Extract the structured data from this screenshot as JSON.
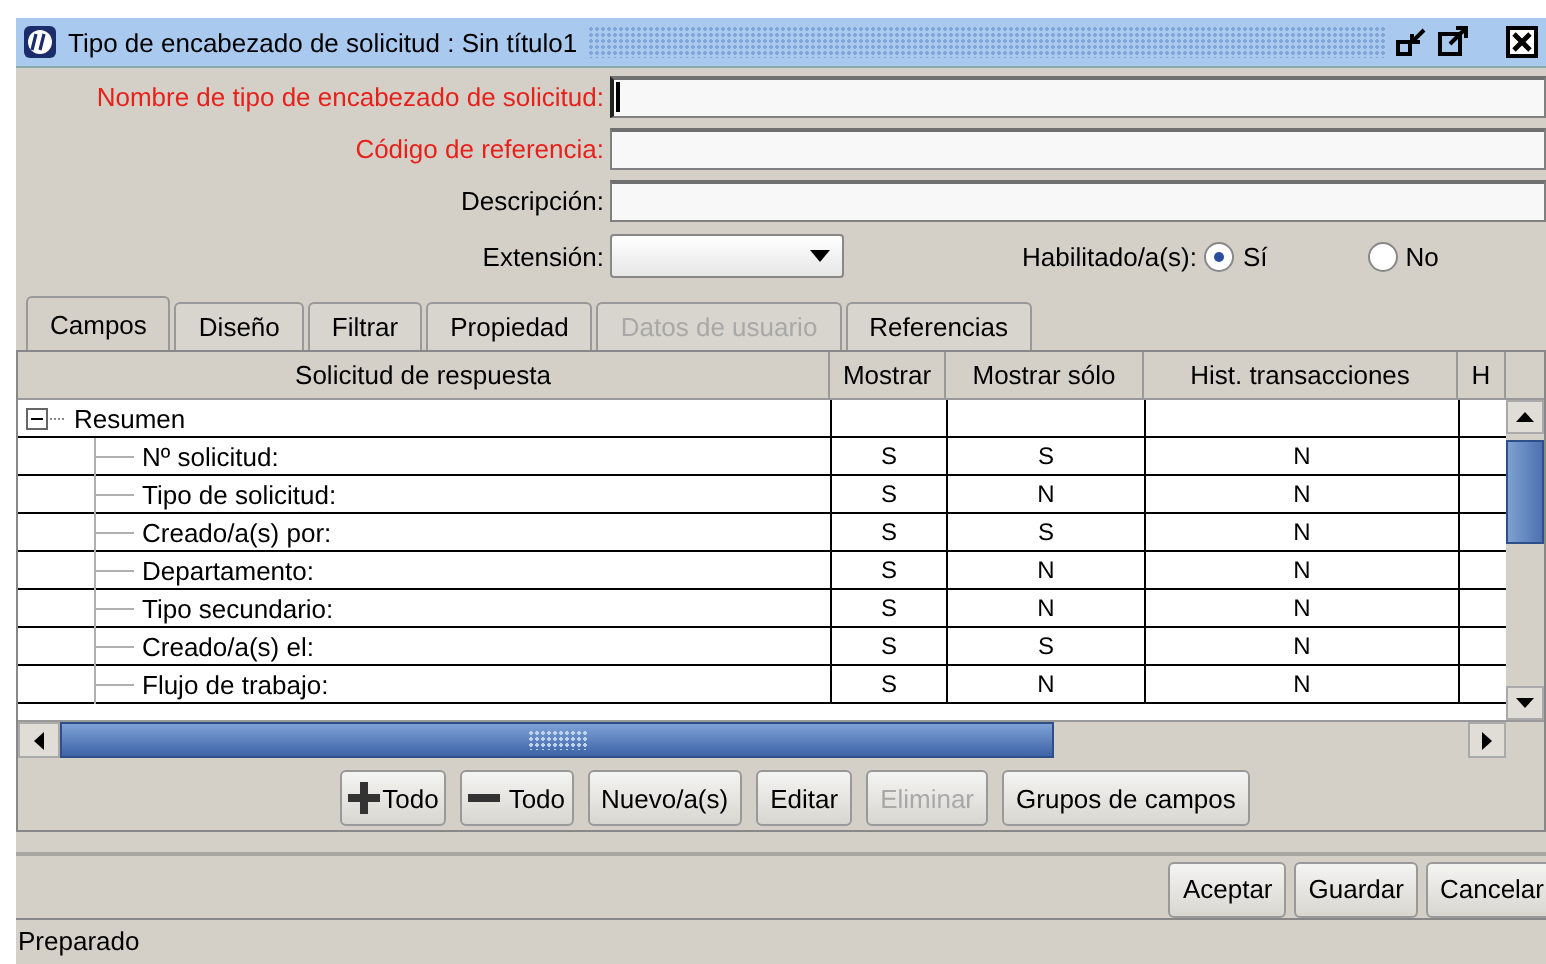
{
  "window": {
    "title": "Tipo de encabezado de solicitud : Sin título1"
  },
  "form": {
    "fields": [
      {
        "label": "Nombre de tipo de encabezado de solicitud:",
        "required": true,
        "focused": true
      },
      {
        "label": "Código de referencia:",
        "required": true,
        "focused": false
      },
      {
        "label": "Descripción:",
        "required": false,
        "focused": false
      }
    ],
    "extension_label": "Extensión:",
    "enabled_label": "Habilitado/a(s):",
    "enabled_options": [
      {
        "label": "Sí",
        "selected": true
      },
      {
        "label": "No",
        "selected": false
      }
    ]
  },
  "tabs": [
    {
      "label": "Campos",
      "selected": true,
      "disabled": false
    },
    {
      "label": "Diseño",
      "selected": false,
      "disabled": false
    },
    {
      "label": "Filtrar",
      "selected": false,
      "disabled": false
    },
    {
      "label": "Propiedad",
      "selected": false,
      "disabled": false
    },
    {
      "label": "Datos de usuario",
      "selected": false,
      "disabled": true
    },
    {
      "label": "Referencias",
      "selected": false,
      "disabled": false
    }
  ],
  "table": {
    "columns": [
      "Solicitud de respuesta",
      "Mostrar",
      "Mostrar sólo",
      "Hist. transacciones",
      "H"
    ],
    "rows": [
      {
        "label": "Resumen",
        "expanded": true,
        "cells": [],
        "children": [
          {
            "label": "Nº solicitud:",
            "cells": [
              "S",
              "S",
              "N"
            ]
          },
          {
            "label": "Tipo de solicitud:",
            "cells": [
              "S",
              "N",
              "N"
            ]
          },
          {
            "label": "Creado/a(s) por:",
            "cells": [
              "S",
              "S",
              "N"
            ]
          },
          {
            "label": "Departamento:",
            "cells": [
              "S",
              "N",
              "N"
            ]
          },
          {
            "label": "Tipo secundario:",
            "cells": [
              "S",
              "N",
              "N"
            ]
          },
          {
            "label": "Creado/a(s) el:",
            "cells": [
              "S",
              "S",
              "N"
            ]
          },
          {
            "label": "Flujo de trabajo:",
            "cells": [
              "S",
              "N",
              "N"
            ]
          }
        ]
      }
    ]
  },
  "field_buttons": [
    {
      "label": "Todo",
      "kind": "add",
      "disabled": false
    },
    {
      "label": "Todo",
      "kind": "remove",
      "disabled": false
    },
    {
      "label": "Nuevo/a(s)",
      "kind": "plain",
      "disabled": false
    },
    {
      "label": "Editar",
      "kind": "plain",
      "disabled": false
    },
    {
      "label": "Eliminar",
      "kind": "plain",
      "disabled": true
    },
    {
      "label": "Grupos de campos",
      "kind": "plain",
      "disabled": false
    }
  ],
  "dialog_buttons": [
    "Aceptar",
    "Guardar",
    "Cancelar"
  ],
  "status_bar": "Preparado"
}
